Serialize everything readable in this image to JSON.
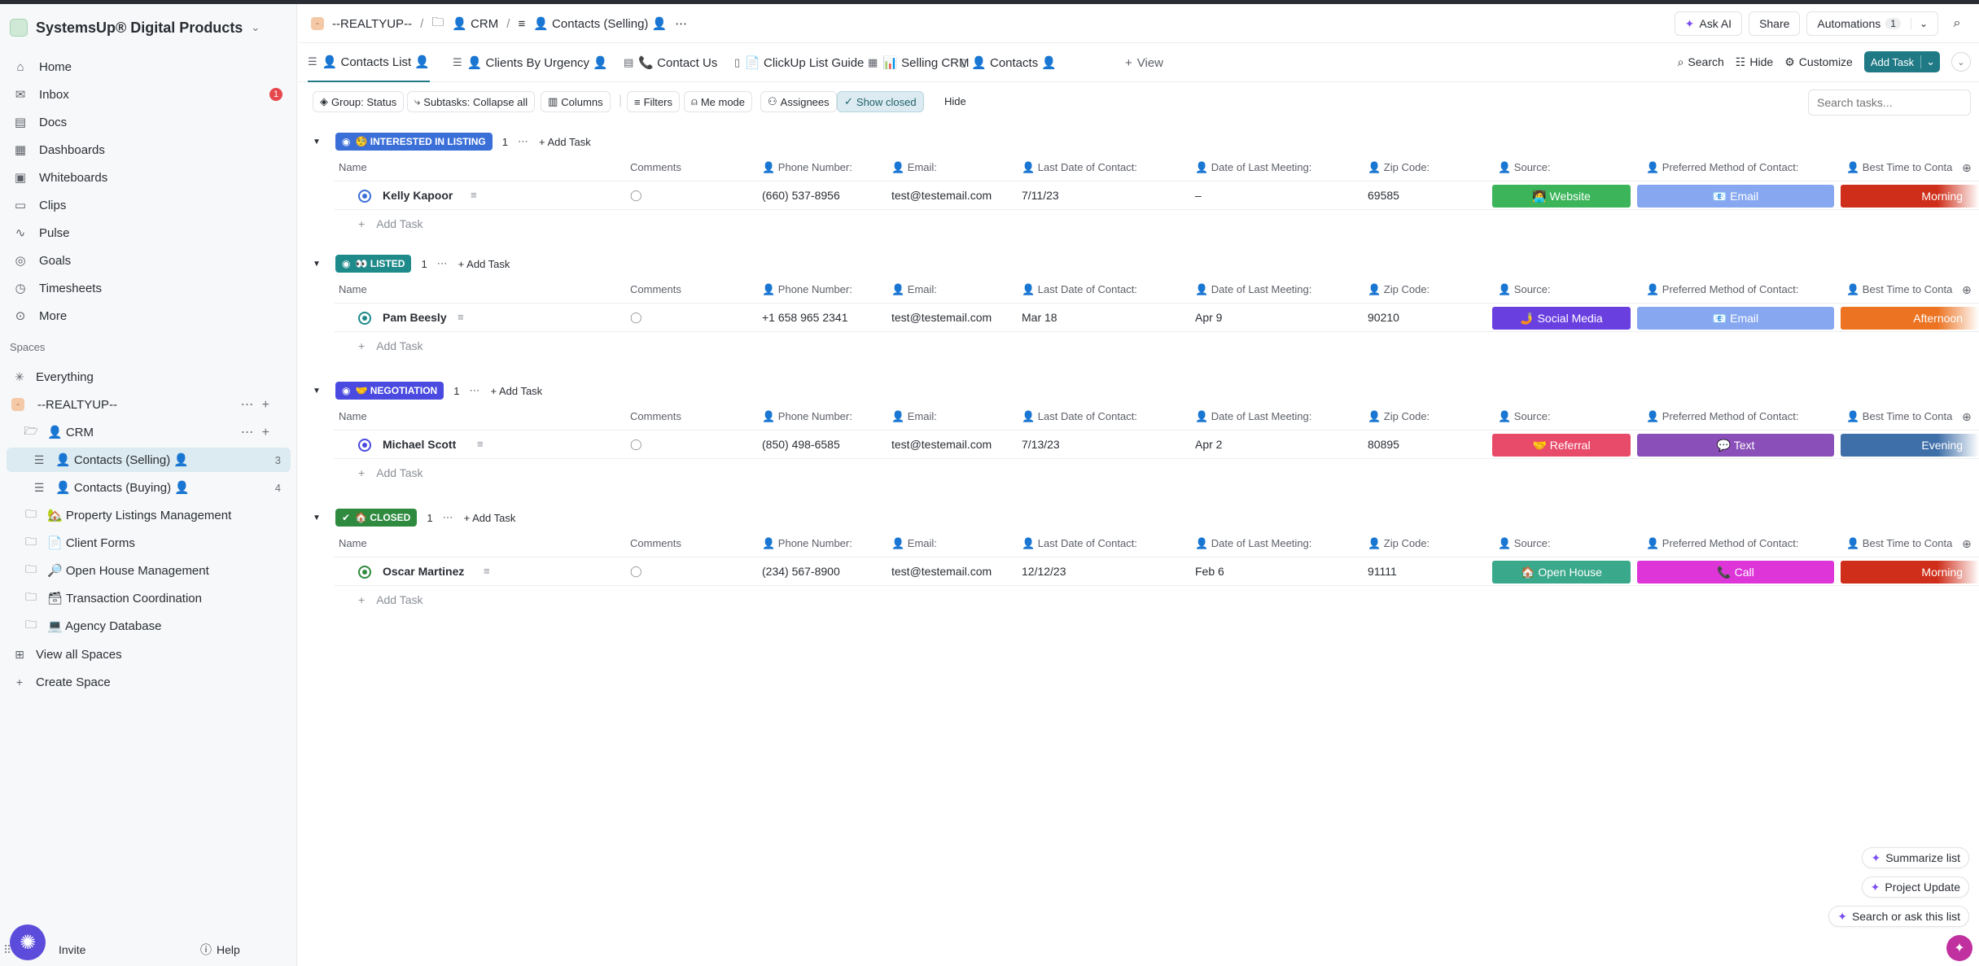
{
  "workspace": {
    "name": "SystemsUp® Digital Products"
  },
  "sidebar": {
    "nav": [
      {
        "label": "Home",
        "icon": "home-icon"
      },
      {
        "label": "Inbox",
        "icon": "inbox-icon",
        "badge": "1"
      },
      {
        "label": "Docs",
        "icon": "docs-icon"
      },
      {
        "label": "Dashboards",
        "icon": "dashboards-icon"
      },
      {
        "label": "Whiteboards",
        "icon": "whiteboards-icon"
      },
      {
        "label": "Clips",
        "icon": "clips-icon"
      },
      {
        "label": "Pulse",
        "icon": "pulse-icon"
      },
      {
        "label": "Goals",
        "icon": "goals-icon"
      },
      {
        "label": "Timesheets",
        "icon": "timesheets-icon"
      },
      {
        "label": "More",
        "icon": "more-icon"
      }
    ],
    "spaces_label": "Spaces",
    "everything": "Everything",
    "space_name": "--REALTYUP--",
    "space_chip": "-",
    "crm": "👤 CRM",
    "lists": [
      {
        "label": "👤 Contacts (Selling) 👤",
        "count": "3"
      },
      {
        "label": "👤 Contacts (Buying) 👤",
        "count": "4"
      }
    ],
    "folders": [
      "🏡 Property Listings Management",
      "📄 Client Forms",
      "🔎 Open House Management",
      "🗃 Transaction Coordination",
      "💻 Agency Database"
    ],
    "view_all": "View all Spaces",
    "create": "Create Space",
    "invite": "Invite",
    "help": "Help"
  },
  "header": {
    "crumbs": [
      "--REALTYUP--",
      "👤 CRM",
      "👤 Contacts (Selling) 👤"
    ],
    "ask_ai": "Ask AI",
    "share": "Share",
    "automations": "Automations",
    "automations_count": "1"
  },
  "views": {
    "tabs": [
      "👤 Contacts List 👤",
      "👤 Clients By Urgency 👤",
      "📞 Contact Us",
      "📄 ClickUp List Guide",
      "📊 Selling CRM",
      "👤 Contacts 👤"
    ],
    "add_view": "View",
    "search": "Search",
    "hide": "Hide",
    "customize": "Customize",
    "add_task": "Add Task"
  },
  "filters": {
    "group": "Group: Status",
    "subtasks": "Subtasks: Collapse all",
    "columns": "Columns",
    "filters": "Filters",
    "me_mode": "Me mode",
    "assignees": "Assignees",
    "show_closed": "Show closed",
    "hide": "Hide",
    "search_placeholder": "Search tasks..."
  },
  "columns": {
    "name": "Name",
    "comments": "Comments",
    "phone": "👤 Phone Number:",
    "email": "👤 Email:",
    "last_contact": "👤 Last Date of Contact:",
    "last_meeting": "👤 Date of Last Meeting:",
    "zip": "👤 Zip Code:",
    "source": "👤 Source:",
    "method": "👤 Preferred Method of Contact:",
    "best_time": "👤 Best Time to Conta"
  },
  "add_task_row": "Add Task",
  "groups": [
    {
      "status": "🧐 INTERESTED IN LISTING",
      "color": "#3b6fd8",
      "count": "1",
      "row": {
        "name": "Kelly Kapoor",
        "phone": "(660) 537-8956",
        "email": "test@testemail.com",
        "last_contact": "7/11/23",
        "last_meeting": "–",
        "zip": "69585",
        "source": "🧑‍💻 Website",
        "source_color": "#3cb55a",
        "method": "📧 Email",
        "method_color": "#87a8f0",
        "time": "Morning",
        "time_color": "#cf2e1a"
      }
    },
    {
      "status": "👀 LISTED",
      "color": "#1f8a8a",
      "count": "1",
      "row": {
        "name": "Pam Beesly",
        "phone": "+1 658 965 2341",
        "email": "test@testemail.com",
        "last_contact": "Mar 18",
        "last_meeting": "Apr 9",
        "zip": "90210",
        "source": "🤳 Social Media",
        "source_color": "#6a3fe0",
        "method": "📧 Email",
        "method_color": "#87a8f0",
        "time": "Afternoon",
        "time_color": "#ec7322"
      }
    },
    {
      "status": "🤝 NEGOTIATION",
      "color": "#4a4ae0",
      "count": "1",
      "row": {
        "name": "Michael Scott",
        "phone": "(850) 498-6585",
        "email": "test@testemail.com",
        "last_contact": "7/13/23",
        "last_meeting": "Apr 2",
        "zip": "80895",
        "source": "🤝 Referral",
        "source_color": "#e84a6a",
        "method": "💬 Text",
        "method_color": "#8a4fb8",
        "time": "Evening",
        "time_color": "#3f6fa8"
      }
    },
    {
      "status": "🏠 CLOSED",
      "color": "#2e8a3e",
      "count": "1",
      "row": {
        "name": "Oscar Martinez",
        "phone": "(234) 567-8900",
        "email": "test@testemail.com",
        "last_contact": "12/12/23",
        "last_meeting": "Feb 6",
        "zip": "91111",
        "source": "🏠 Open House",
        "source_color": "#3aa88a",
        "method": "📞 Call",
        "method_color": "#dd35d8",
        "time": "Morning",
        "time_color": "#cf2e1a"
      }
    }
  ],
  "ai": {
    "summarize": "Summarize list",
    "project_update": "Project Update",
    "search_ask": "Search or ask this list"
  }
}
